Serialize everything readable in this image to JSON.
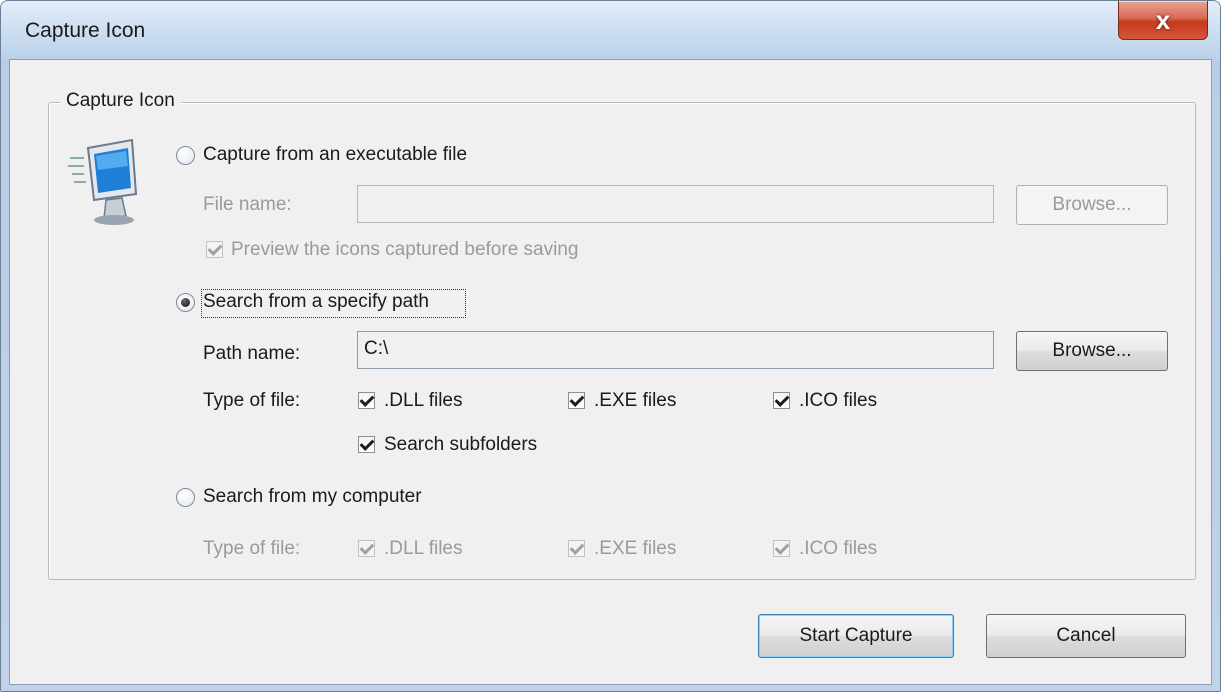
{
  "window": {
    "title": "Capture Icon",
    "close_glyph": "x"
  },
  "group": {
    "legend": "Capture Icon",
    "icon": "computer-monitor-icon"
  },
  "option_executable": {
    "label": "Capture from an executable file",
    "file_name_label": "File name:",
    "file_name_value": "",
    "browse_label": "Browse...",
    "preview_label": "Preview the icons captured before saving"
  },
  "option_path": {
    "label": "Search from a specify path",
    "path_label": "Path name:",
    "path_value": "C:\\",
    "browse_label": "Browse...",
    "type_label": "Type of file:",
    "dll_label": ".DLL files",
    "exe_label": ".EXE files",
    "ico_label": ".ICO files",
    "subfolders_label": "Search subfolders"
  },
  "option_computer": {
    "label": "Search from my computer",
    "type_label": "Type of file:",
    "dll_label": ".DLL files",
    "exe_label": ".EXE files",
    "ico_label": ".ICO files"
  },
  "buttons": {
    "start": "Start Capture",
    "cancel": "Cancel"
  }
}
